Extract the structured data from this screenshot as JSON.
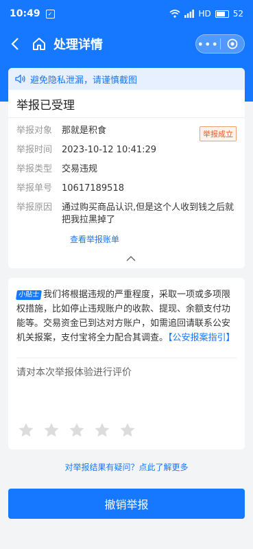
{
  "status_bar": {
    "time": "10:49",
    "battery": "52",
    "network": "HD"
  },
  "nav": {
    "title": "处理详情"
  },
  "privacy_notice": "避免隐私泄漏，请谨慎截图",
  "report_status": "举报已受理",
  "badge": "举报成立",
  "details": [
    {
      "key": "举报对象",
      "value": "那就是积食"
    },
    {
      "key": "举报时间",
      "value": "2023-10-12 10:41:29"
    },
    {
      "key": "举报类型",
      "value": "交易违规"
    },
    {
      "key": "举报单号",
      "value": "10617189518"
    },
    {
      "key": "举报原因",
      "value": "通过购买商品认识,但是这个人收到钱之后就把我拉黑掉了"
    }
  ],
  "view_account_link": "查看举报账单",
  "tip": {
    "tag": "小贴士",
    "text": "我们将根据违规的严重程度，采取一项或多项限权措施，比如停止违规账户的收款、提现、余额支付功能等。交易资金已到达对方账户，如需追回请联系公安机关报案，支付宝将全力配合其调查。",
    "link": "【公安报案指引】"
  },
  "rating": {
    "label": "请对本次举报体验进行评价",
    "max_stars": 5,
    "selected": 0
  },
  "doubt_link": "对举报结果有疑问？点此了解更多",
  "cancel_button": "撤销举报",
  "colors": {
    "brand": "#1677ff",
    "badge": "#e4602e"
  }
}
